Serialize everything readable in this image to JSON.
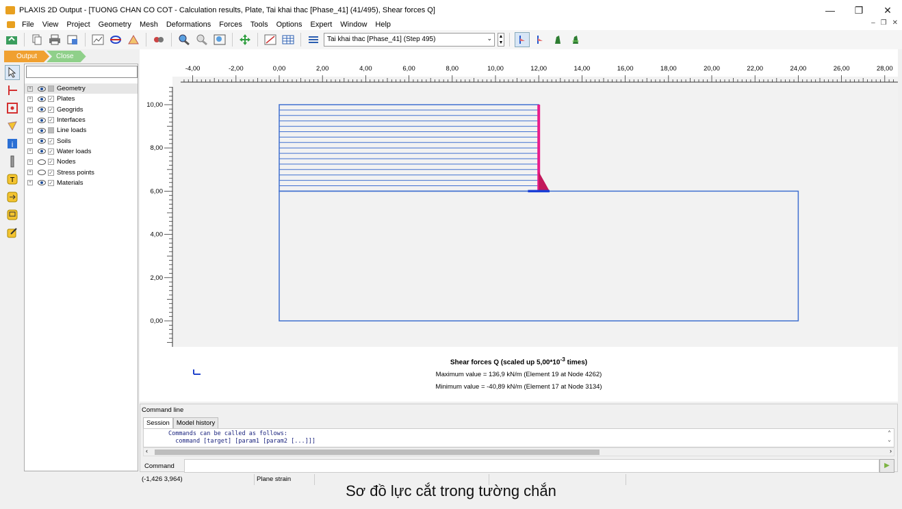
{
  "window": {
    "title": "PLAXIS 2D Output - [TUONG CHAN CO COT - Calculation results, Plate, Tai khai thac [Phase_41] (41/495), Shear forces Q]",
    "controls": [
      "—",
      "❐",
      "✕"
    ]
  },
  "menu": [
    "File",
    "View",
    "Project",
    "Geometry",
    "Mesh",
    "Deformations",
    "Forces",
    "Tools",
    "Options",
    "Expert",
    "Window",
    "Help"
  ],
  "toolbar": {
    "phase_value": "Tai khai thac [Phase_41] (Step 495)"
  },
  "crumbs": {
    "output": "Output",
    "close": "Close"
  },
  "explorer": {
    "items": [
      {
        "label": "Geometry",
        "eye": "half",
        "check": "partial"
      },
      {
        "label": "Plates",
        "eye": "on",
        "check": "checked"
      },
      {
        "label": "Geogrids",
        "eye": "on",
        "check": "checked"
      },
      {
        "label": "Interfaces",
        "eye": "on",
        "check": "checked"
      },
      {
        "label": "Line loads",
        "eye": "half",
        "check": "partial"
      },
      {
        "label": "Soils",
        "eye": "on",
        "check": "checked"
      },
      {
        "label": "Water loads",
        "eye": "half",
        "check": "checked"
      },
      {
        "label": "Nodes",
        "eye": "off",
        "check": "checked"
      },
      {
        "label": "Stress points",
        "eye": "off",
        "check": "checked"
      },
      {
        "label": "Materials",
        "eye": "on",
        "check": "checked"
      }
    ]
  },
  "plot": {
    "x_ticks": [
      "-4,00",
      "-2,00",
      "0,00",
      "2,00",
      "4,00",
      "6,00",
      "8,00",
      "10,00",
      "12,00",
      "14,00",
      "16,00",
      "18,00",
      "20,00",
      "22,00",
      "24,00",
      "26,00",
      "28,00"
    ],
    "y_ticks": [
      "10,00",
      "8,00",
      "6,00",
      "4,00",
      "2,00",
      "0,00"
    ],
    "colors": {
      "mesh": "#3f6fd0",
      "plate": "#1a3fd6",
      "shear": "#e91e8c",
      "axis": "#333333"
    }
  },
  "results": {
    "title_prefix": "Shear forces Q (scaled up 5,00*10",
    "title_exp": "-3",
    "title_suffix": " times)",
    "max_line": "Maximum value = 136,9 kN/m (Element 19 at Node 4262)",
    "min_line": "Minimum value = -40,89 kN/m (Element 17 at Node 3134)"
  },
  "command": {
    "panel_title": "Command line",
    "tabs": [
      "Session",
      "Model history"
    ],
    "session_lines": [
      "Commands can be called as follows:",
      "  command [target] [param1 [param2 [...]]]"
    ],
    "input_label": "Command"
  },
  "status": {
    "coords": "(-1,426 3,964)",
    "mode": "Plane strain"
  },
  "caption": "Sơ đồ lực cắt trong tường chắn"
}
